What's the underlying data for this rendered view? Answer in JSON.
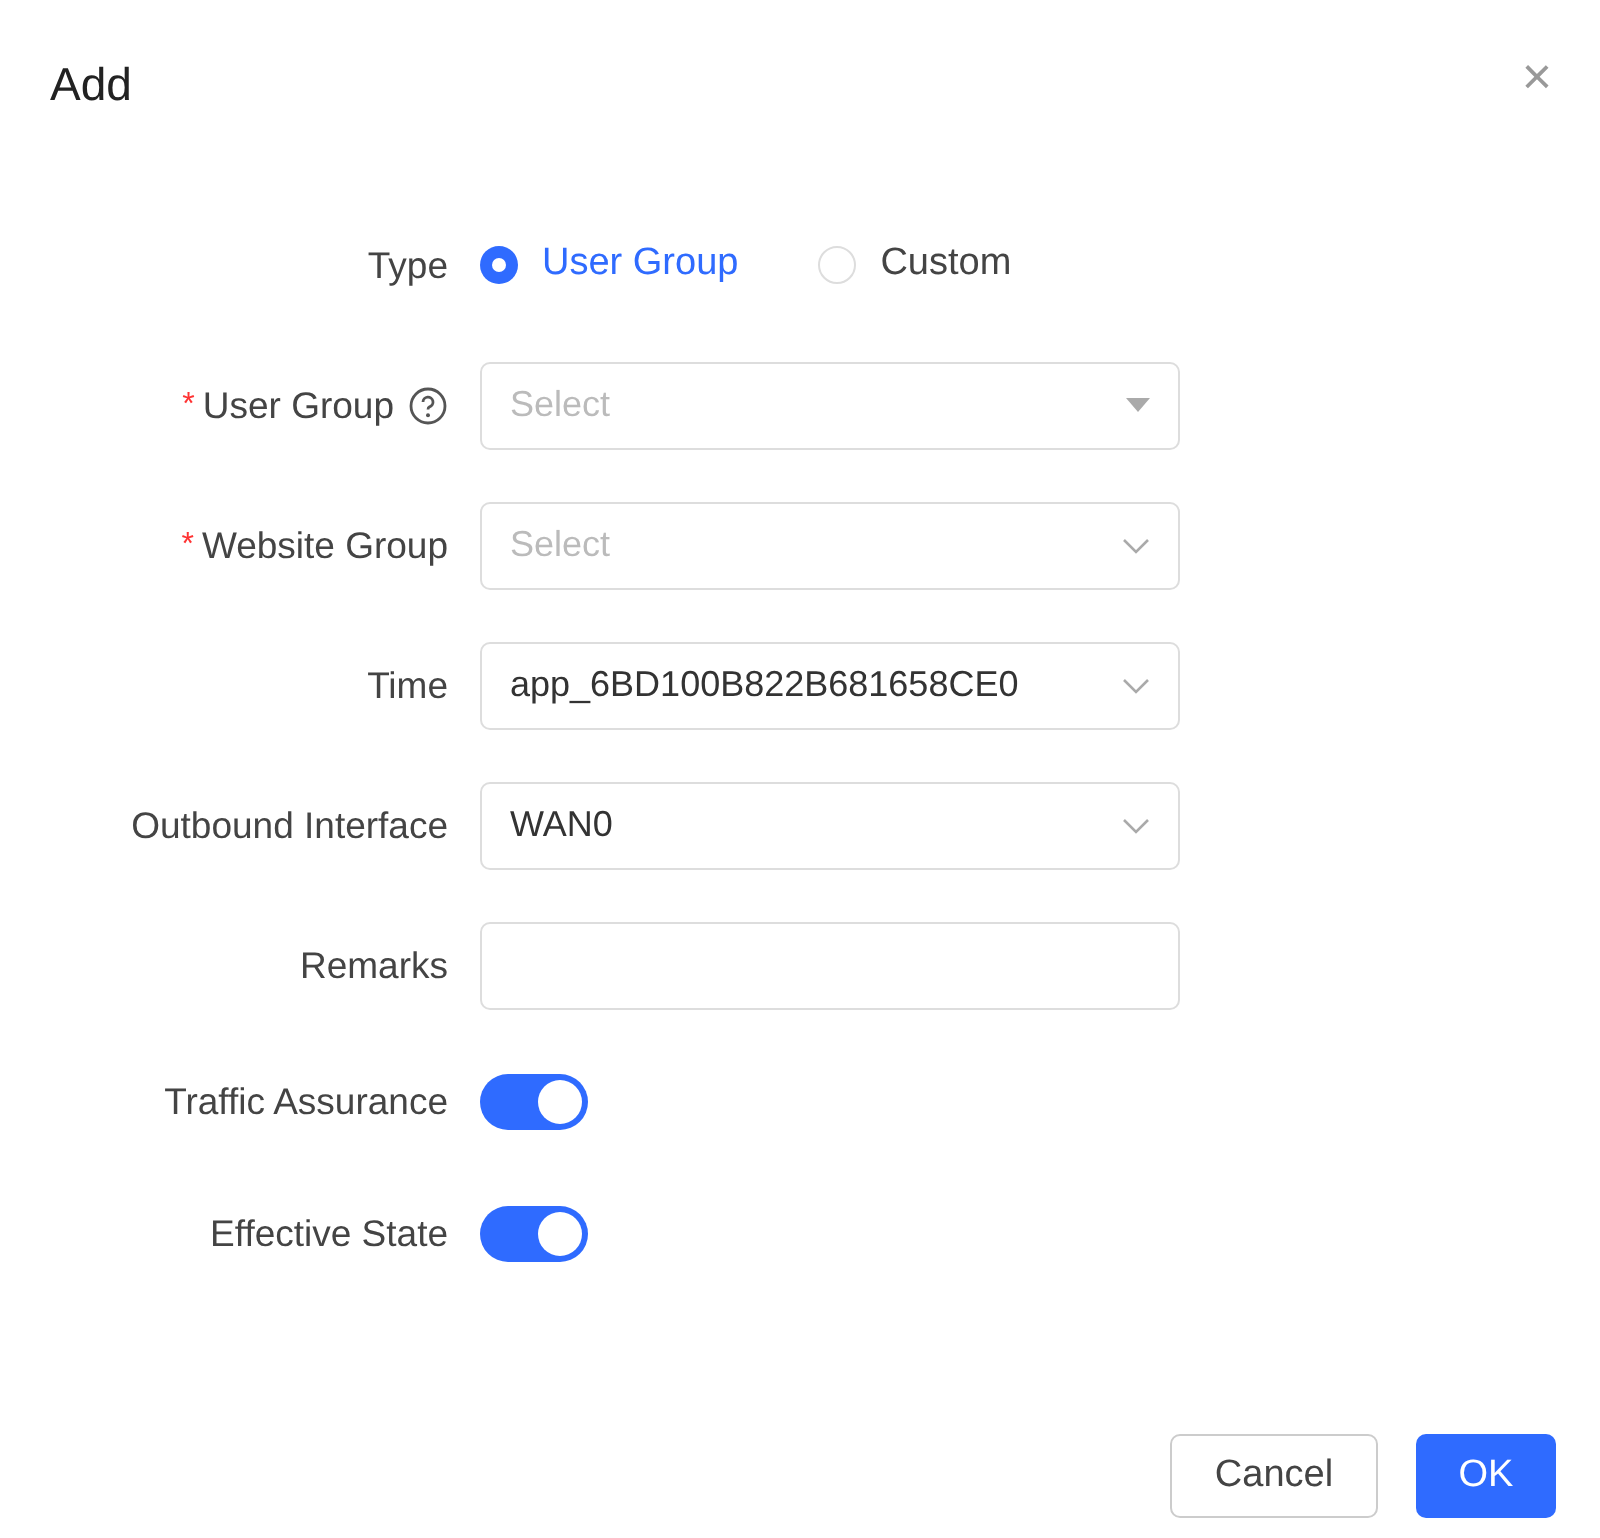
{
  "dialog": {
    "title": "Add",
    "close": "×"
  },
  "fields": [
    {
      "kind": "radio",
      "label": "Type",
      "help": false,
      "options": [
        {
          "label": "User Group",
          "selected": true
        },
        {
          "label": "Custom",
          "selected": false
        }
      ]
    },
    {
      "kind": "dropdown",
      "label": "User Group",
      "required_mark": "*",
      "help": true,
      "placeholder": "Select"
    },
    {
      "kind": "select",
      "label": "Website Group",
      "required_mark": "*",
      "help": false,
      "placeholder": "Select"
    },
    {
      "kind": "select",
      "label": "Time",
      "help": false,
      "value": "app_6BD100B822B681658CE0"
    },
    {
      "kind": "select",
      "label": "Outbound Interface",
      "help": false,
      "value": "WAN0"
    },
    {
      "kind": "text",
      "label": "Remarks",
      "help": false
    },
    {
      "kind": "switch",
      "label": "Traffic Assurance",
      "help": false,
      "on": true
    },
    {
      "kind": "switch",
      "label": "Effective State",
      "help": false,
      "on": true
    }
  ],
  "buttons": [
    {
      "label": "Cancel",
      "kind": "secondary"
    },
    {
      "label": "OK",
      "kind": "primary"
    }
  ]
}
